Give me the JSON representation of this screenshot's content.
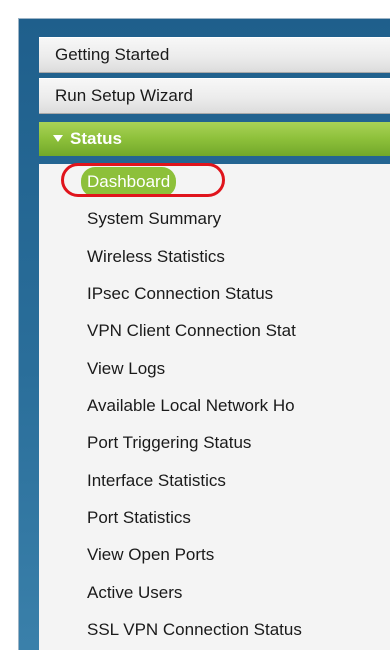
{
  "menu": {
    "top_items": [
      {
        "label": "Getting Started"
      },
      {
        "label": "Run Setup Wizard"
      }
    ],
    "status": {
      "label": "Status",
      "items": [
        {
          "label": "Dashboard",
          "selected": true
        },
        {
          "label": "System Summary"
        },
        {
          "label": "Wireless Statistics"
        },
        {
          "label": "IPsec Connection Status"
        },
        {
          "label": "VPN Client Connection Stat"
        },
        {
          "label": "View Logs"
        },
        {
          "label": "Available Local Network Ho"
        },
        {
          "label": "Port Triggering Status"
        },
        {
          "label": "Interface Statistics"
        },
        {
          "label": "Port Statistics"
        },
        {
          "label": "View Open Ports"
        },
        {
          "label": "Active Users"
        },
        {
          "label": "SSL VPN Connection Status"
        }
      ]
    }
  },
  "colors": {
    "status_header": "#8dc03a",
    "selected_bg": "#8dc03a",
    "highlight_ring": "#e0141c",
    "panel_blue": "#2a6e9a"
  }
}
